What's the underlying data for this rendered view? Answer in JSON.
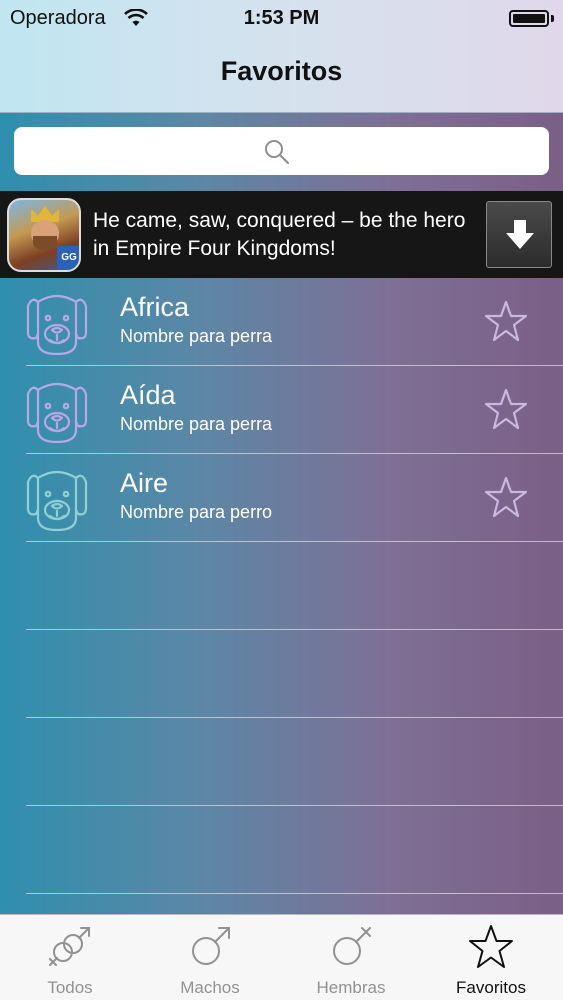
{
  "status_bar": {
    "carrier": "Operadora",
    "time": "1:53 PM"
  },
  "nav": {
    "title": "Favoritos"
  },
  "search": {
    "placeholder": ""
  },
  "ad": {
    "text": "He came, saw, conquered – be the hero in Empire Four Kingdoms!",
    "icon_badge": "GG"
  },
  "list": {
    "items": [
      {
        "name": "Africa",
        "subtitle": "Nombre para perra",
        "icon": "dog-icon",
        "icon_color": "#b9a8e8",
        "favorite": false
      },
      {
        "name": "Aída",
        "subtitle": "Nombre para perra",
        "icon": "dog-icon",
        "icon_color": "#b9a8e8",
        "favorite": false
      },
      {
        "name": "Aire",
        "subtitle": "Nombre para perro",
        "icon": "dog-icon",
        "icon_color": "#8fd0d4",
        "favorite": false
      }
    ]
  },
  "tabs": [
    {
      "label": "Todos",
      "icon": "male-female-icon",
      "active": false
    },
    {
      "label": "Machos",
      "icon": "male-icon",
      "active": false
    },
    {
      "label": "Hembras",
      "icon": "female-icon",
      "active": false
    },
    {
      "label": "Favoritos",
      "icon": "star-icon",
      "active": true
    }
  ],
  "colors": {
    "tab_inactive": "#929292",
    "tab_active": "#111111",
    "ad_background": "#161616"
  }
}
